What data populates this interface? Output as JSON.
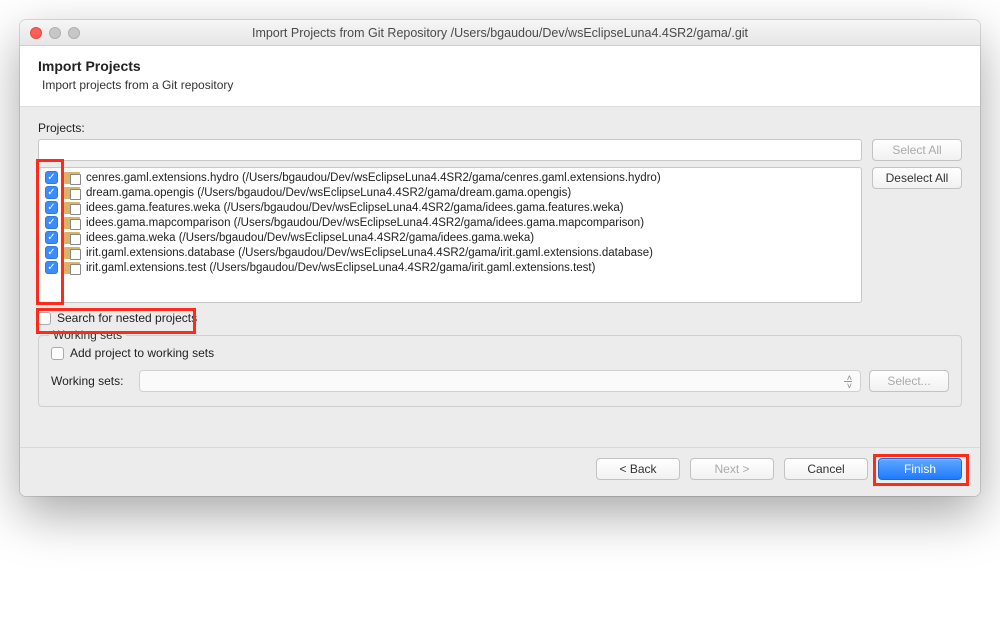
{
  "window_title": "Import Projects from Git Repository /Users/bgaudou/Dev/wsEclipseLuna4.4SR2/gama/.git",
  "header": {
    "title": "Import Projects",
    "subtitle": "Import projects from a Git repository"
  },
  "projects_label": "Projects:",
  "filter_value": "",
  "buttons": {
    "select_all": "Select All",
    "deselect_all": "Deselect All",
    "select_ws": "Select...",
    "back": "< Back",
    "next": "Next >",
    "cancel": "Cancel",
    "finish": "Finish"
  },
  "projects": [
    {
      "name": "cenres.gaml.extensions.hydro",
      "path": "(/Users/bgaudou/Dev/wsEclipseLuna4.4SR2/gama/cenres.gaml.extensions.hydro)",
      "checked": true
    },
    {
      "name": "dream.gama.opengis",
      "path": "(/Users/bgaudou/Dev/wsEclipseLuna4.4SR2/gama/dream.gama.opengis)",
      "checked": true
    },
    {
      "name": "idees.gama.features.weka",
      "path": "(/Users/bgaudou/Dev/wsEclipseLuna4.4SR2/gama/idees.gama.features.weka)",
      "checked": true
    },
    {
      "name": "idees.gama.mapcomparison",
      "path": "(/Users/bgaudou/Dev/wsEclipseLuna4.4SR2/gama/idees.gama.mapcomparison)",
      "checked": true
    },
    {
      "name": "idees.gama.weka",
      "path": "(/Users/bgaudou/Dev/wsEclipseLuna4.4SR2/gama/idees.gama.weka)",
      "checked": true
    },
    {
      "name": "irit.gaml.extensions.database",
      "path": "(/Users/bgaudou/Dev/wsEclipseLuna4.4SR2/gama/irit.gaml.extensions.database)",
      "checked": true
    },
    {
      "name": "irit.gaml.extensions.test",
      "path": "(/Users/bgaudou/Dev/wsEclipseLuna4.4SR2/gama/irit.gaml.extensions.test)",
      "checked": true
    }
  ],
  "search_nested": {
    "checked": false,
    "label": "Search for nested projects"
  },
  "working_sets": {
    "group_label": "Working sets",
    "add_label": "Add project to working sets",
    "add_checked": false,
    "row_label": "Working sets:",
    "combo_value": ""
  },
  "highlights": [
    "checkboxes",
    "nested-projects",
    "finish-button"
  ]
}
